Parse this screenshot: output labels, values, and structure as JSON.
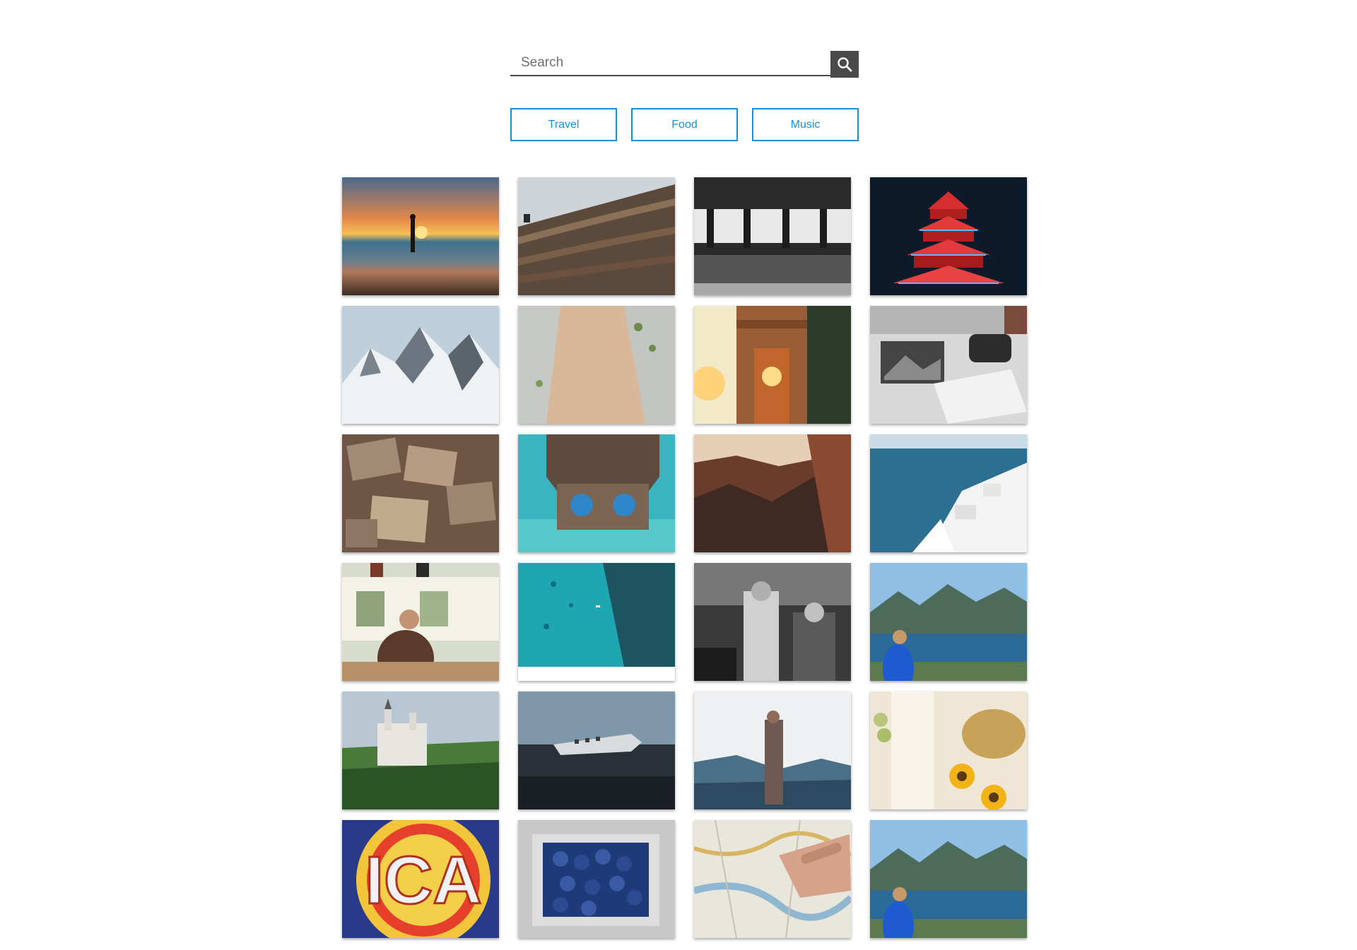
{
  "search": {
    "placeholder": "Search",
    "value": ""
  },
  "categories": [
    {
      "label": "Travel"
    },
    {
      "label": "Food"
    },
    {
      "label": "Music"
    }
  ],
  "colors": {
    "accent": "#1a8fd6",
    "search_button": "#4a4a4a"
  },
  "photos": [
    {
      "subject": "beach-sunset"
    },
    {
      "subject": "library-shelves"
    },
    {
      "subject": "subway-platform"
    },
    {
      "subject": "red-pagoda-night"
    },
    {
      "subject": "snowy-mountains"
    },
    {
      "subject": "rock-cliff-aerial"
    },
    {
      "subject": "arc-de-triomphe-sunset"
    },
    {
      "subject": "laptop-and-book"
    },
    {
      "subject": "scattered-maps"
    },
    {
      "subject": "hut-over-water-aerial"
    },
    {
      "subject": "canyon-view"
    },
    {
      "subject": "santorini-coast"
    },
    {
      "subject": "cafe-interior"
    },
    {
      "subject": "turquoise-sea-aerial"
    },
    {
      "subject": "black-white-street"
    },
    {
      "subject": "fjord-hiker"
    },
    {
      "subject": "castle-forest"
    },
    {
      "subject": "plane-wreck-beach"
    },
    {
      "subject": "woman-mountain-lookout"
    },
    {
      "subject": "sunflowers-straw-hat"
    },
    {
      "subject": "chicago-theatre-sign"
    },
    {
      "subject": "blueberries"
    },
    {
      "subject": "hand-on-map"
    },
    {
      "subject": "fjord-hiker"
    }
  ]
}
